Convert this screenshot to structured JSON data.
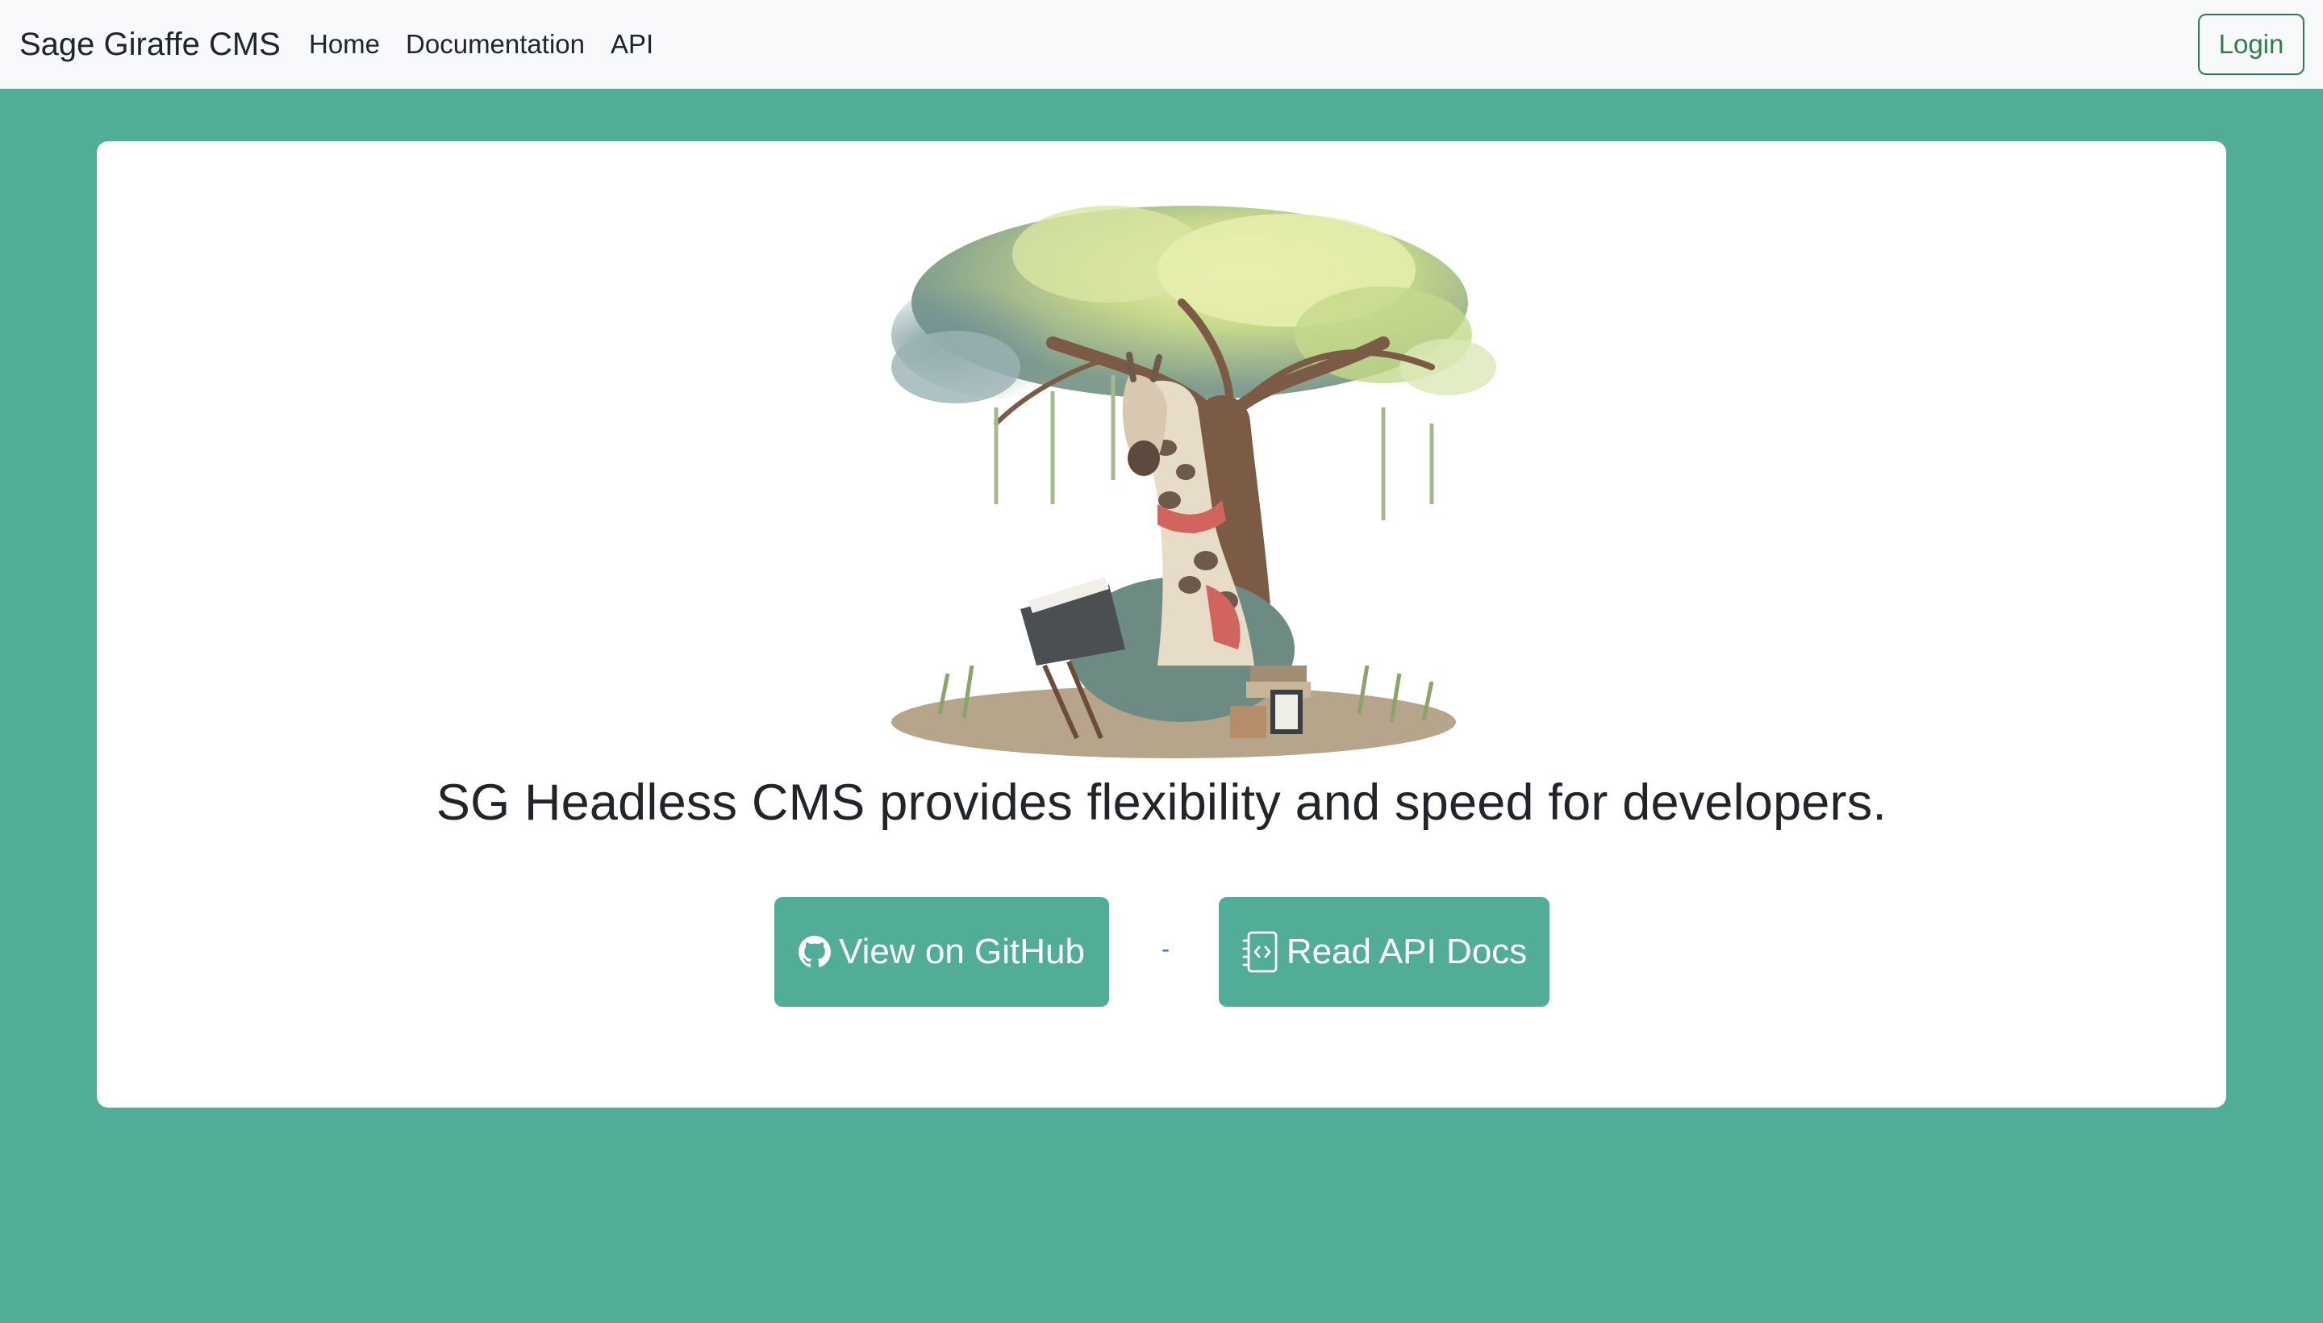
{
  "navbar": {
    "brand": "Sage Giraffe CMS",
    "links": [
      {
        "label": "Home"
      },
      {
        "label": "Documentation"
      },
      {
        "label": "API"
      }
    ],
    "login_label": "Login"
  },
  "hero": {
    "image_icon": "giraffe-reading-under-tree-illustration",
    "headline": "SG Headless CMS provides flexibility and speed for developers.",
    "separator": "-",
    "buttons": {
      "github": {
        "label": "View on GitHub",
        "icon": "github-icon"
      },
      "docs": {
        "label": "Read API Docs",
        "icon": "api-docs-icon"
      }
    }
  },
  "colors": {
    "page_background": "#52ad98",
    "navbar_background": "#f8f9fa",
    "button_background": "#52ad98",
    "login_outline": "#2f7d4e",
    "card_background": "#ffffff"
  }
}
